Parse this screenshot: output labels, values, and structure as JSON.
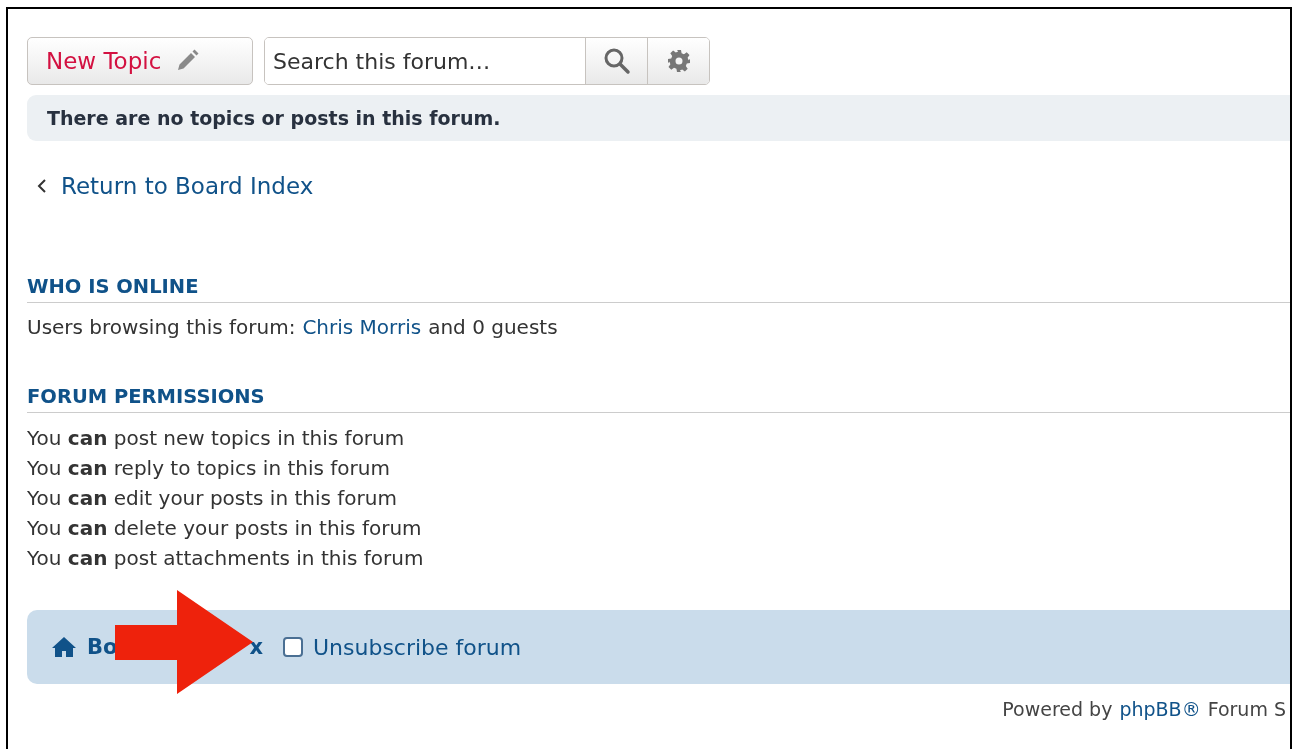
{
  "action_bar": {
    "new_topic": "New Topic",
    "search": {
      "placeholder": "Search this forum…"
    }
  },
  "notice": "There are no topics or posts in this forum.",
  "return_link": "Return to Board Index",
  "who_is_online": {
    "heading": "WHO IS ONLINE",
    "prefix": "Users browsing this forum:",
    "user": "Chris Morris",
    "suffix": "and 0 guests"
  },
  "permissions": {
    "heading": "FORUM PERMISSIONS",
    "lines": [
      {
        "text": "You **can** post new topics in this forum"
      },
      {
        "text": "You **can** reply to topics in this forum"
      },
      {
        "text": "You **can** edit your posts in this forum"
      },
      {
        "text": "You **can** delete your posts in this forum"
      },
      {
        "text": "You **can** post attachments in this forum"
      }
    ]
  },
  "footer_bar": {
    "board_index_visible": [
      "Bo",
      "x"
    ],
    "unsubscribe": {
      "label": "Unsubscribe forum",
      "checked": false
    }
  },
  "powered_by": {
    "prefix": "Powered by",
    "link": "phpBB®",
    "suffix": "Forum S"
  }
}
